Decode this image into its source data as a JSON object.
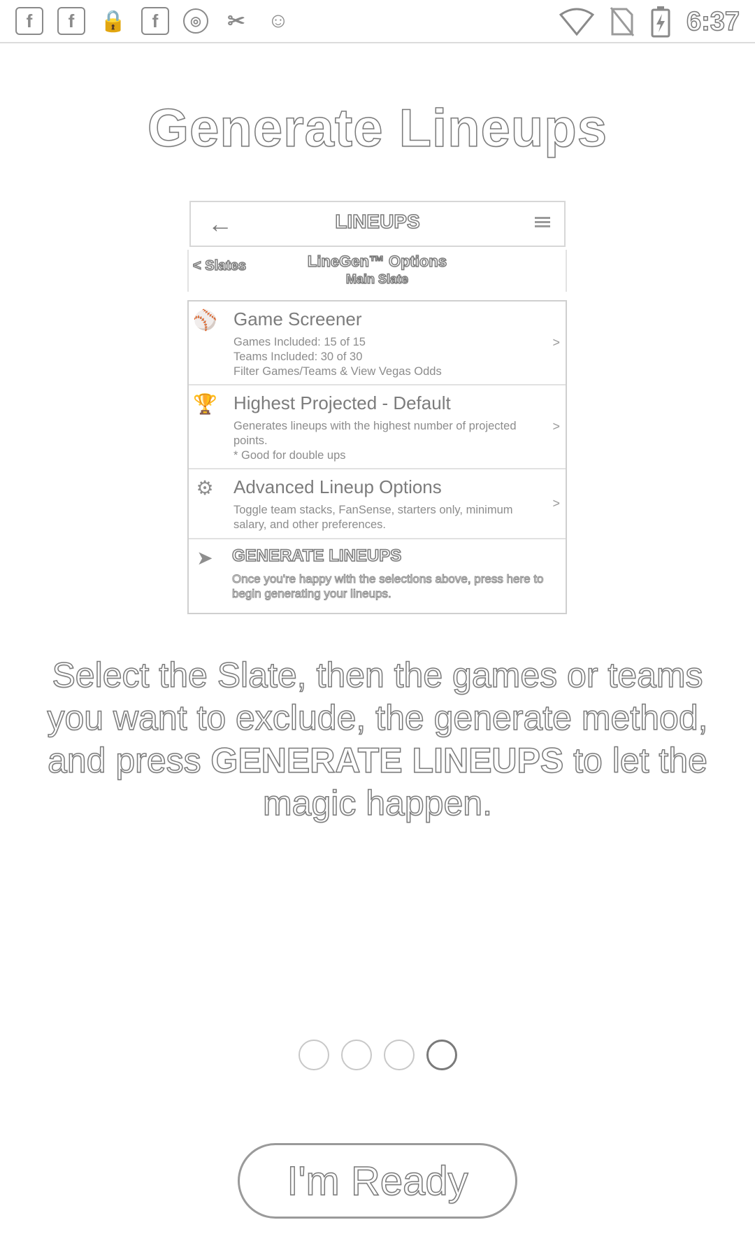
{
  "status_bar": {
    "icons": [
      "facebook-icon",
      "facebook-icon",
      "lock-icon",
      "facebook-icon",
      "circle-icon",
      "fantasy-app-icon",
      "android-icon"
    ],
    "glyphs": [
      "f",
      "f",
      "🔒",
      "f",
      "◎",
      "✂",
      "☺"
    ],
    "right_icons": [
      "wifi-icon",
      "no-sim-icon",
      "battery-charging-icon"
    ],
    "time": "6:37"
  },
  "title": "Generate Lineups",
  "mock": {
    "header_title": "LINEUPS",
    "slates_link": "< Slates",
    "options_title": "LineGen™ Options",
    "options_subtitle": "Main Slate",
    "items": [
      {
        "icon": "baseball-icon",
        "title": "Game Screener",
        "desc": "Games Included: 15 of 15\nTeams Included: 30 of 30\nFilter Games/Teams & View Vegas Odds",
        "chevron": ">"
      },
      {
        "icon": "trophy-icon",
        "title": "Highest Projected - Default",
        "desc": "Generates lineups with the highest number of projected points.\n* Good for double ups",
        "chevron": ">"
      },
      {
        "icon": "gear-icon",
        "title": "Advanced Lineup Options",
        "desc": "Toggle team stacks, FanSense, starters only, minimum salary, and other preferences.",
        "chevron": ">"
      }
    ],
    "generate": {
      "icon": "send-icon",
      "title": "GENERATE LINEUPS",
      "desc": "Once you're happy with the selections above, press here to begin generating your lineups."
    }
  },
  "instruction": {
    "part1": "Select the Slate, then the games or teams you want to exclude, the generate method, and press ",
    "bold": "GENERATE LINEUPS",
    "part2": " to let the magic happen."
  },
  "pager": {
    "total": 4,
    "active_index": 3
  },
  "ready_button": "I'm Ready"
}
